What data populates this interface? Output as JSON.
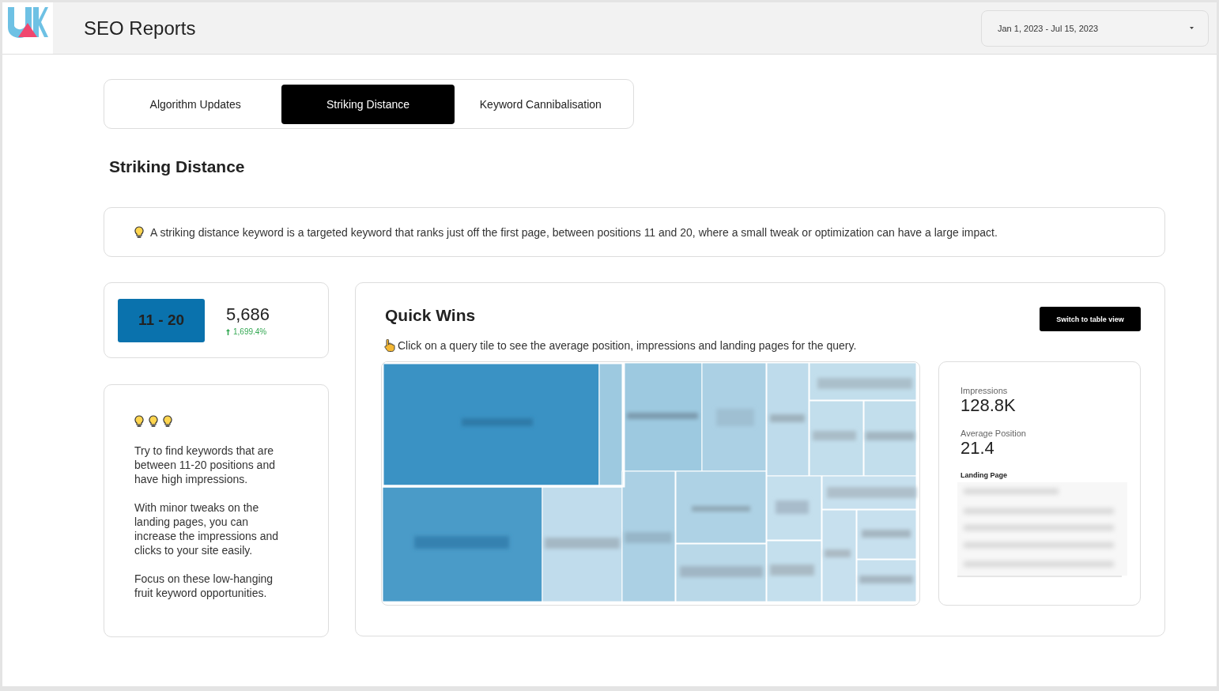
{
  "header": {
    "title": "SEO Reports",
    "date_range": "Jan 1, 2023 - Jul 15, 2023"
  },
  "tabs": [
    {
      "label": "Algorithm Updates",
      "selected": false
    },
    {
      "label": "Striking Distance",
      "selected": true
    },
    {
      "label": "Keyword Cannibalisation",
      "selected": false
    }
  ],
  "section_title": "Striking Distance",
  "info": "A striking distance keyword is a targeted keyword that ranks just off the first page, between positions 11 and 20, where a small tweak or optimization can have a large impact.",
  "range_card": {
    "badge": "11 - 20",
    "value": "5,686",
    "change": "1,699.4%",
    "increase": true
  },
  "tips": {
    "paragraphs": [
      "Try to find keywords that are between 11-20 positions and have high impressions.",
      "With minor tweaks on the landing pages, you can increase the impressions and clicks to your site easily.",
      "Focus on these low-hanging fruit keyword opportunities."
    ]
  },
  "quick_wins": {
    "title": "Quick Wins",
    "button": "Switch to table view",
    "hint": "Click on a query tile to see the average position, impressions and landing pages for the query.",
    "details": {
      "metrics": [
        {
          "label": "Impressions",
          "value": "128.8K"
        },
        {
          "label": "Average Position",
          "value": "21.4"
        }
      ],
      "landing_page_label": "Landing Page"
    }
  }
}
